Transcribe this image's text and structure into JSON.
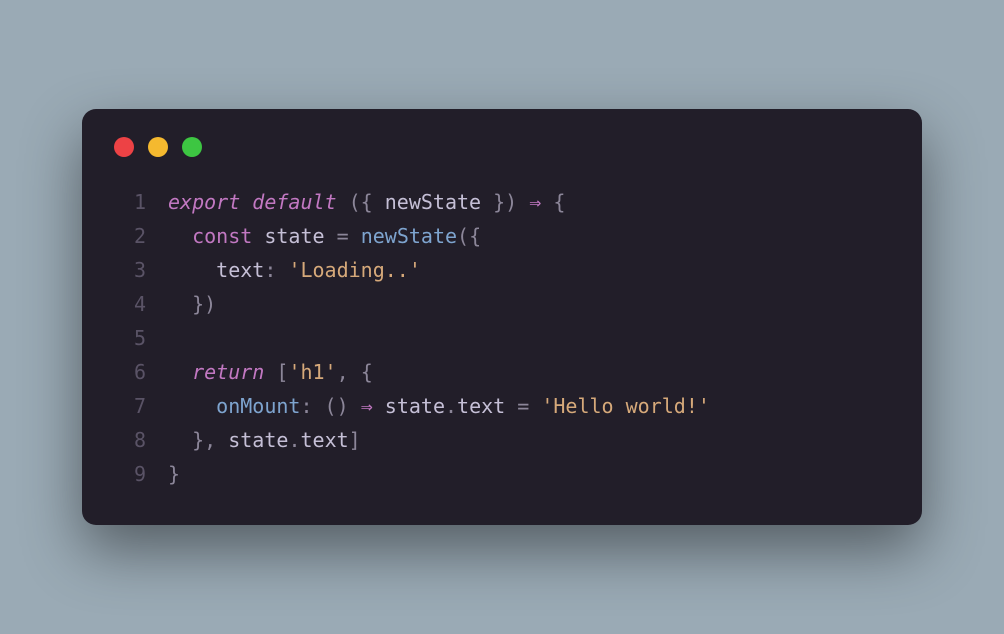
{
  "window": {
    "dots": [
      "red",
      "yellow",
      "green"
    ]
  },
  "code": {
    "lines": [
      {
        "n": "1",
        "tokens": [
          {
            "c": "kw-italic",
            "t": "export"
          },
          {
            "c": "var",
            "t": " "
          },
          {
            "c": "kw-italic",
            "t": "default"
          },
          {
            "c": "var",
            "t": " "
          },
          {
            "c": "punct",
            "t": "({ "
          },
          {
            "c": "var",
            "t": "newState"
          },
          {
            "c": "punct",
            "t": " }) "
          },
          {
            "c": "arrow",
            "t": "⇒"
          },
          {
            "c": "punct",
            "t": " {"
          }
        ]
      },
      {
        "n": "2",
        "tokens": [
          {
            "c": "var",
            "t": "  "
          },
          {
            "c": "kw",
            "t": "const"
          },
          {
            "c": "var",
            "t": " state "
          },
          {
            "c": "punct",
            "t": "= "
          },
          {
            "c": "fn",
            "t": "newState"
          },
          {
            "c": "punct",
            "t": "({"
          }
        ]
      },
      {
        "n": "3",
        "tokens": [
          {
            "c": "var",
            "t": "    "
          },
          {
            "c": "prop",
            "t": "text"
          },
          {
            "c": "punct",
            "t": ": "
          },
          {
            "c": "str",
            "t": "'Loading..'"
          }
        ]
      },
      {
        "n": "4",
        "tokens": [
          {
            "c": "var",
            "t": "  "
          },
          {
            "c": "punct",
            "t": "})"
          }
        ]
      },
      {
        "n": "5",
        "tokens": []
      },
      {
        "n": "6",
        "tokens": [
          {
            "c": "var",
            "t": "  "
          },
          {
            "c": "kw-italic",
            "t": "return"
          },
          {
            "c": "var",
            "t": " "
          },
          {
            "c": "punct",
            "t": "["
          },
          {
            "c": "str",
            "t": "'h1'"
          },
          {
            "c": "punct",
            "t": ", {"
          }
        ]
      },
      {
        "n": "7",
        "tokens": [
          {
            "c": "var",
            "t": "    "
          },
          {
            "c": "fn",
            "t": "onMount"
          },
          {
            "c": "punct",
            "t": ": () "
          },
          {
            "c": "arrow",
            "t": "⇒"
          },
          {
            "c": "var",
            "t": " state"
          },
          {
            "c": "punct",
            "t": "."
          },
          {
            "c": "prop",
            "t": "text"
          },
          {
            "c": "var",
            "t": " "
          },
          {
            "c": "punct",
            "t": "= "
          },
          {
            "c": "str",
            "t": "'Hello world!'"
          }
        ]
      },
      {
        "n": "8",
        "tokens": [
          {
            "c": "var",
            "t": "  "
          },
          {
            "c": "punct",
            "t": "}, "
          },
          {
            "c": "var",
            "t": "state"
          },
          {
            "c": "punct",
            "t": "."
          },
          {
            "c": "prop",
            "t": "text"
          },
          {
            "c": "punct",
            "t": "]"
          }
        ]
      },
      {
        "n": "9",
        "tokens": [
          {
            "c": "punct",
            "t": "}"
          }
        ]
      }
    ]
  }
}
